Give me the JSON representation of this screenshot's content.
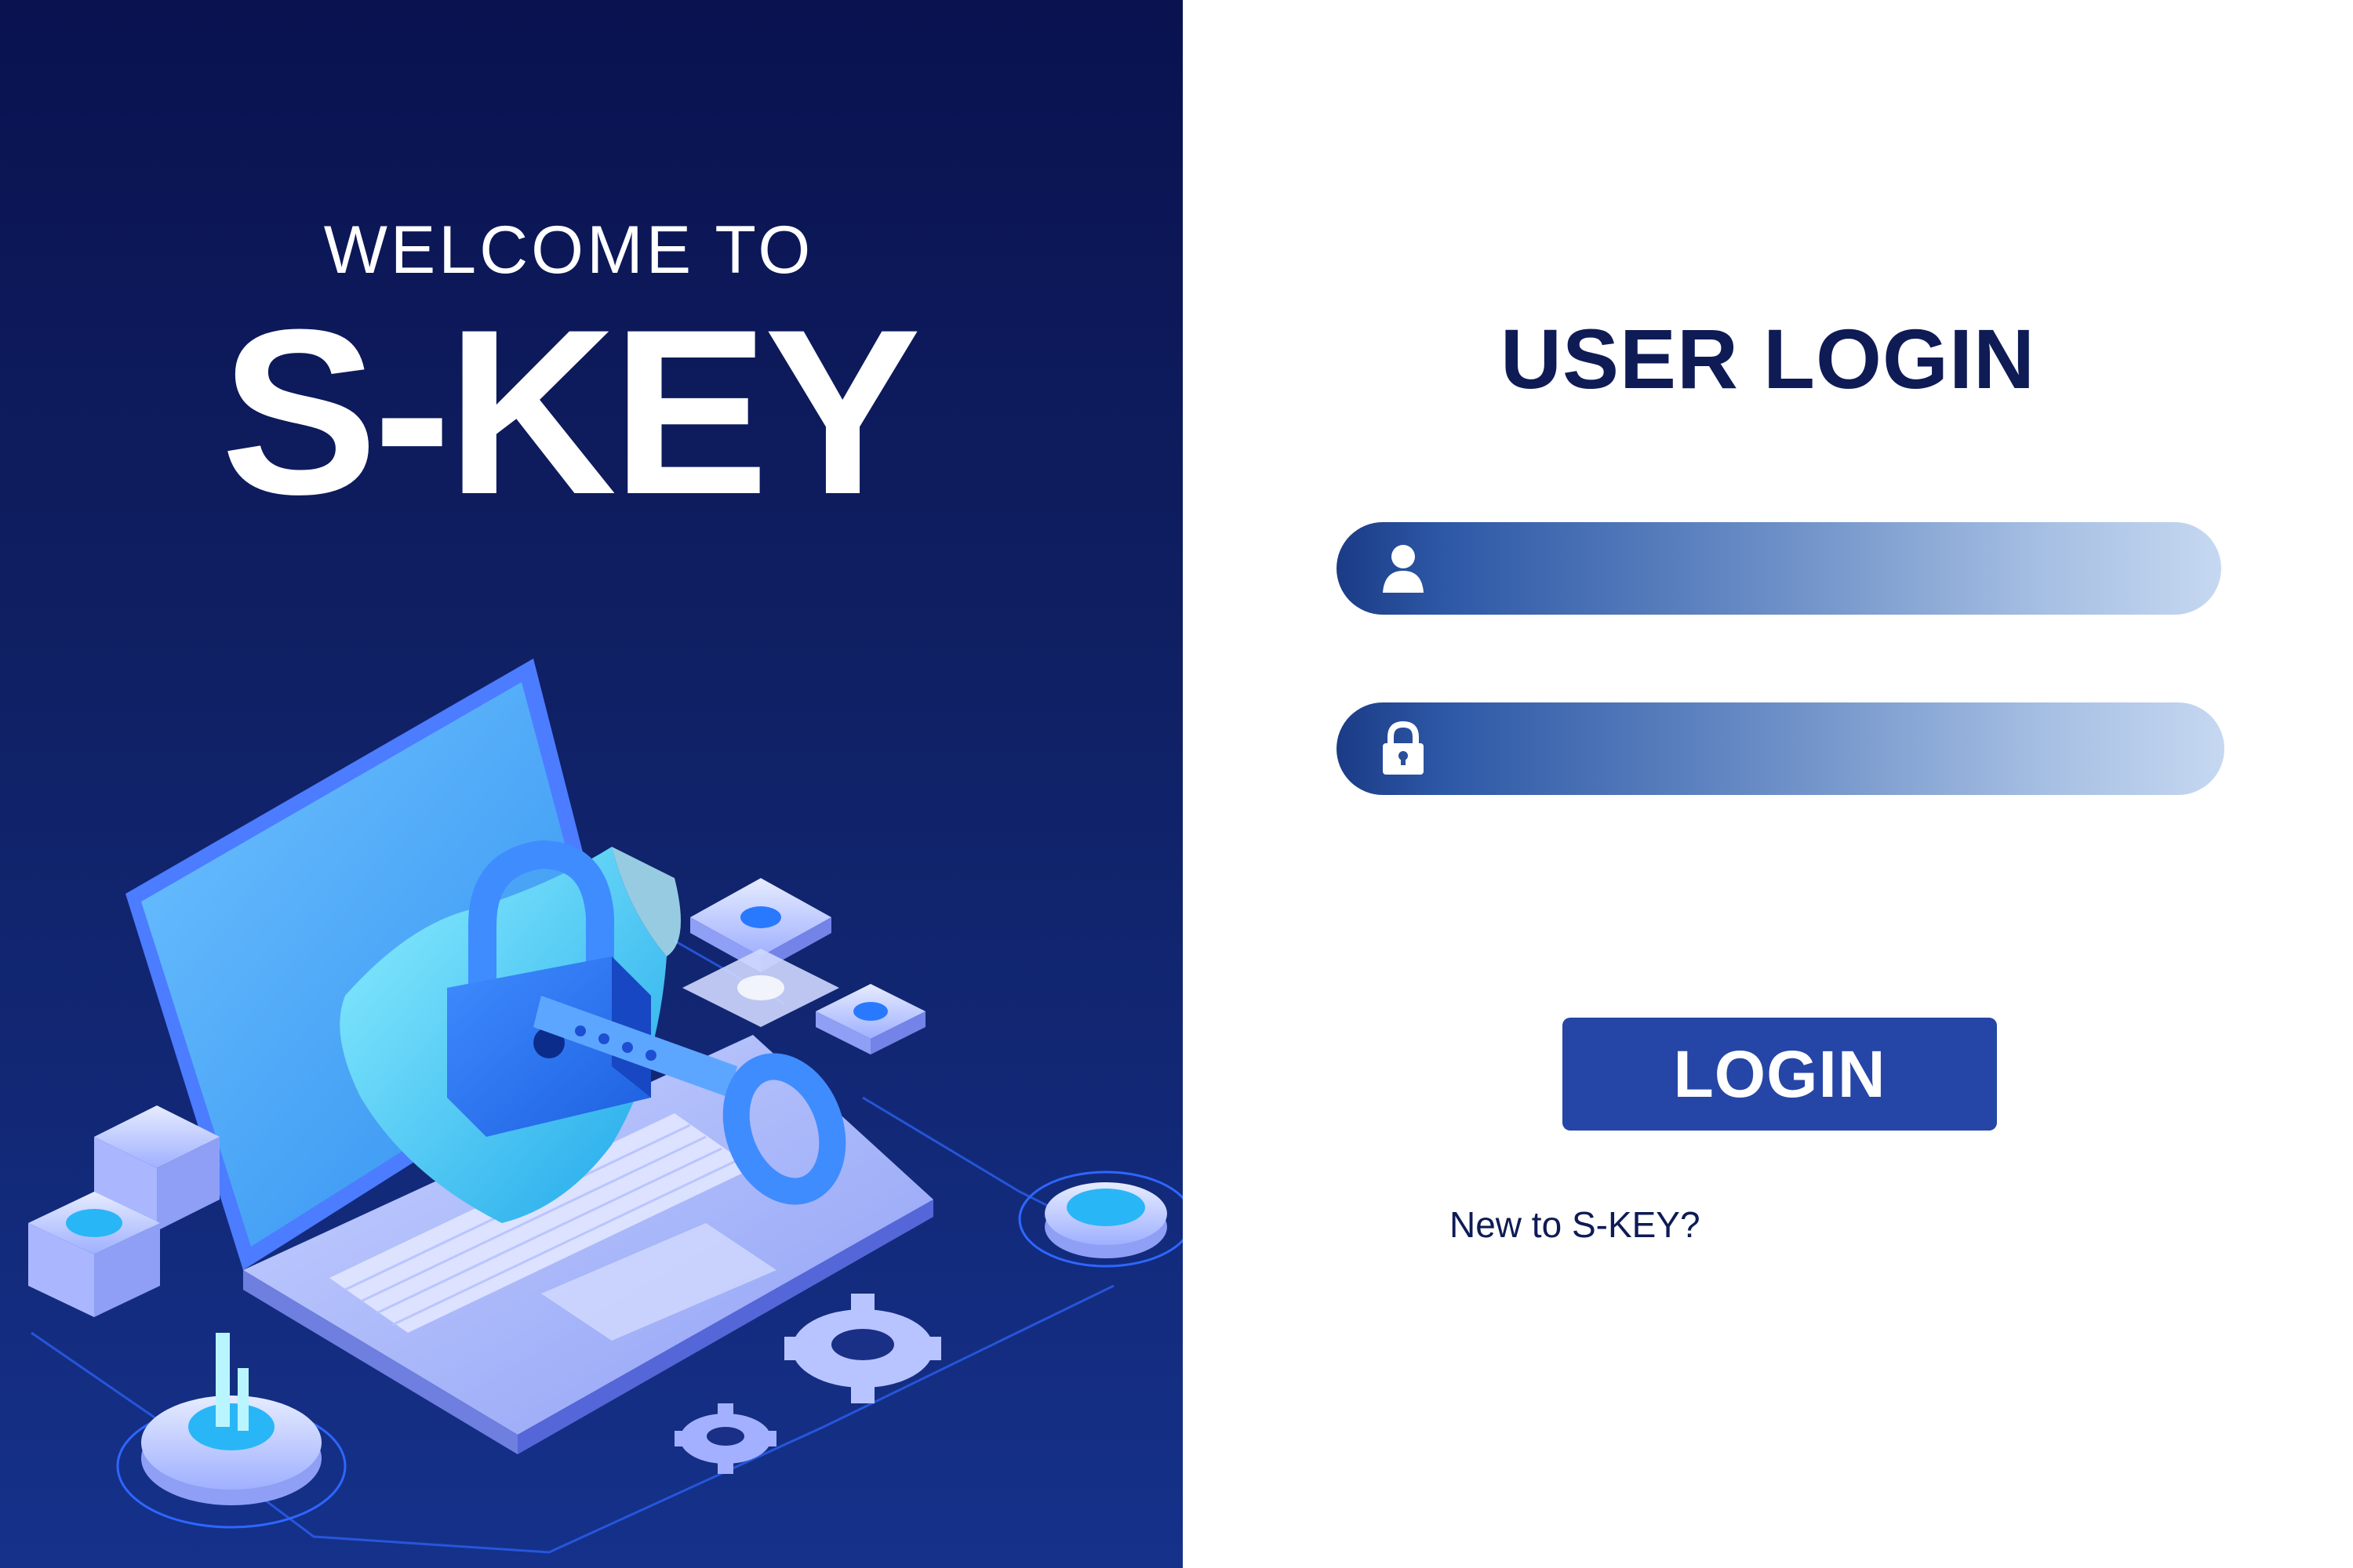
{
  "hero": {
    "welcome": "WELCOME TO",
    "brand": "S-KEY"
  },
  "login": {
    "title": "USER LOGIN",
    "username_icon": "user-icon",
    "password_icon": "lock-icon",
    "username_value": "",
    "password_value": "",
    "button_label": "LOGIN",
    "signup_link": "New to S-KEY?"
  },
  "colors": {
    "navy": "#0f1b55",
    "button": "#2546a6",
    "panel_top": "#0a1250",
    "panel_bottom": "#15318a",
    "illustration_cyan": "#29b6f6",
    "illustration_lavender": "#a9b5ff"
  }
}
